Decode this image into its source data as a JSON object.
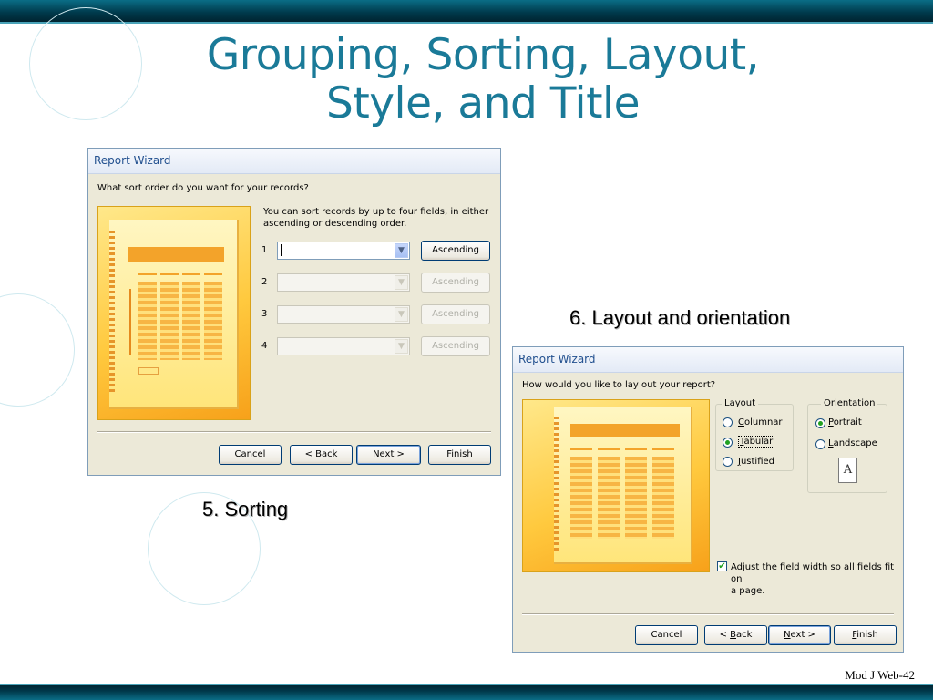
{
  "slide": {
    "title_line1": "Grouping, Sorting, Layout,",
    "title_line2": "Style, and Title",
    "caption_sorting": "5.  Sorting",
    "caption_layout": "6.  Layout and orientation",
    "slide_number": "Mod J Web-42"
  },
  "colors": {
    "title": "#1a7a98",
    "top_bar": "#00384a",
    "dialog_bg": "#ece9d8",
    "dialog_title": "#22508f"
  },
  "sort_dialog": {
    "title": "Report Wizard",
    "question": "What sort order do you want for your records?",
    "help_line1": "You can sort records by up to four fields, in either",
    "help_line2": "ascending or descending order.",
    "rows": [
      {
        "num": "1",
        "value": "",
        "order": "Ascending",
        "enabled": true
      },
      {
        "num": "2",
        "value": "",
        "order": "Ascending",
        "enabled": false
      },
      {
        "num": "3",
        "value": "",
        "order": "Ascending",
        "enabled": false
      },
      {
        "num": "4",
        "value": "",
        "order": "Ascending",
        "enabled": false
      }
    ],
    "buttons": {
      "cancel": "Cancel",
      "back": "< Back",
      "next": "Next >",
      "finish": "Finish"
    }
  },
  "layout_dialog": {
    "title": "Report Wizard",
    "question": "How would you like to lay out your report?",
    "layout_legend": "Layout",
    "layout_options": [
      "Columnar",
      "Tabular",
      "Justified"
    ],
    "layout_selected": "Tabular",
    "orientation_legend": "Orientation",
    "orientation_options": [
      "Portrait",
      "Landscape"
    ],
    "orientation_selected": "Portrait",
    "orientation_icon_letter": "A",
    "adjust_checked": true,
    "adjust_line1": "Adjust the field width so all fields fit on",
    "adjust_line2": "a page.",
    "buttons": {
      "cancel": "Cancel",
      "back": "< Back",
      "next": "Next >",
      "finish": "Finish"
    }
  }
}
